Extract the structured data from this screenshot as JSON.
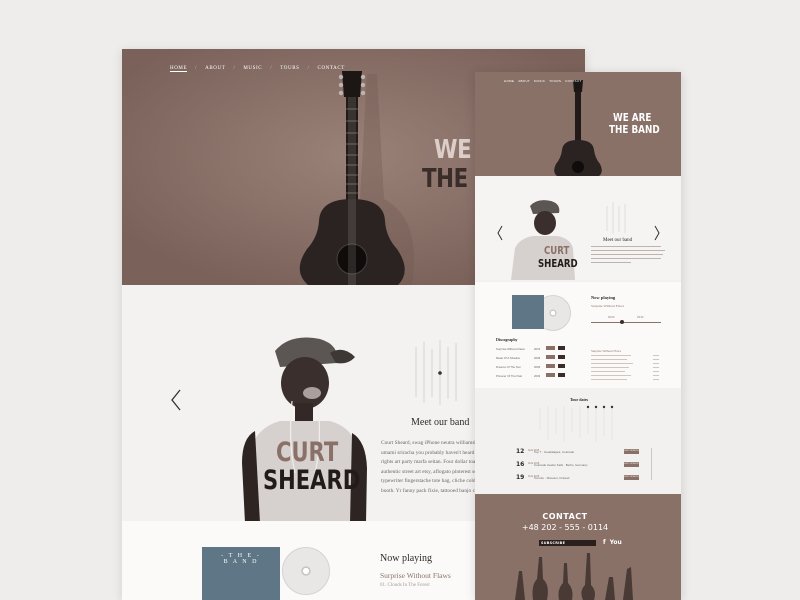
{
  "desktop": {
    "nav": {
      "items": [
        "HOME",
        "ABOUT",
        "MUSIC",
        "TOURS",
        "CONTACT"
      ],
      "separator": "/"
    },
    "hero": {
      "line1": "WE A",
      "line2": "THE B"
    },
    "member": {
      "name_first": "CURT",
      "name_last": "SHEARD",
      "section_title": "Meet our band",
      "bio": "Court Sheard, swag iPhone neutra williamsburg. Austin artisan tattooed art party, street art umami sriracha you probably haven't heard of them Pinterest farm-to-table. Ethical bicycle rights art party marfa seitan. Four dollar toast wayfarers before they sold out, locavore authentic street art etsy, aflogato pinterest schlitz. Squid yr salvia organic Pitchfork. Truffaut typewriter fingerstache tote bag, cliche cold-pressed tattooed pour-over polaroid photo booth. Yr fanny pack fixie, tattooed banjo cliche mustache locavore schlitz kogi."
    },
    "music": {
      "now_playing": "Now playing",
      "track": "Surprise Without Flaws",
      "subtitle": "01. Clouds In The Forest",
      "album_title": "- T H E -\nB A N D"
    }
  },
  "mobile": {
    "nav": {
      "items": [
        "HOME",
        "ABOUT",
        "MUSIC",
        "TOURS",
        "CONTACT"
      ]
    },
    "hero": {
      "line1": "WE ARE",
      "line2": "THE BAND"
    },
    "member": {
      "name_first": "CURT",
      "name_last": "SHEARD",
      "section_title": "Meet our band"
    },
    "music": {
      "now_playing": "Now playing",
      "track": "Surprise Without Flaws",
      "time_left": "00:00",
      "time_right": "03:34",
      "track_list_title": "Surprise Without Flaws",
      "discography_title": "Discography",
      "discography": [
        {
          "title": "Surprise Without Flaws",
          "year": "2015"
        },
        {
          "title": "Made Of A Shadow",
          "year": "2009"
        },
        {
          "title": "Dreams Of The Sun",
          "year": "2005"
        },
        {
          "title": "Prisoner Of The Past",
          "year": "2003"
        }
      ]
    },
    "tours": {
      "title": "Tour dates",
      "items": [
        {
          "day": "12",
          "month": "AUG 2015",
          "city": "Top 7 · Guadalajara, Colorado",
          "button": "BUY TICKETS"
        },
        {
          "day": "16",
          "month": "AUG 2015",
          "city": "Colorado Avalon Falls · Berlin, Germany",
          "button": "BUY TICKETS"
        },
        {
          "day": "19",
          "month": "AUG 2015",
          "city": "Toronto · Missouri, Finland",
          "button": "BUY TICKETS"
        }
      ]
    },
    "contact": {
      "title": "CONTACT",
      "phone": "+48 202 - 555 - 0114",
      "subscribe": "SUBSCRIBE",
      "social": [
        "f",
        "You"
      ]
    }
  },
  "colors": {
    "brand_mauve": "#8a7168",
    "dark_brown": "#2a1f1c",
    "page_bg": "#efedeb"
  }
}
